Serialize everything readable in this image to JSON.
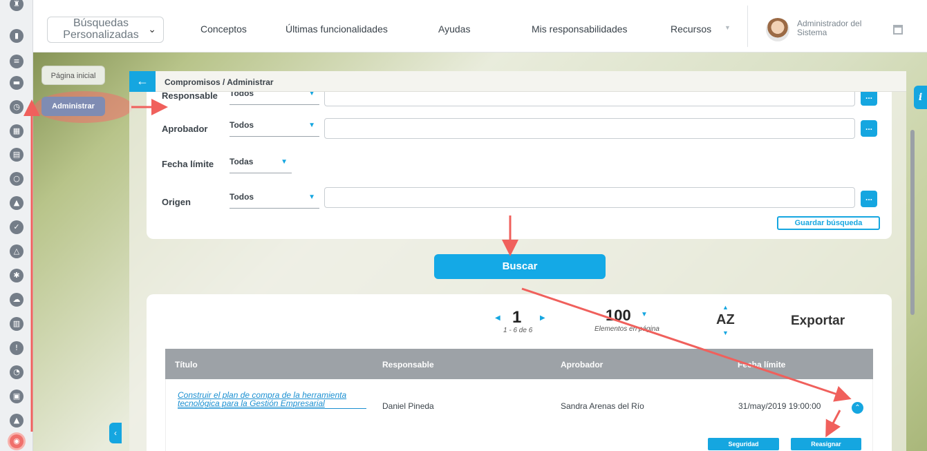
{
  "header": {
    "dropdown_label": "Búsquedas Personalizadas",
    "nav": [
      "Conceptos",
      "Últimas funcionalidades",
      "Ayudas",
      "Mis responsabilidades",
      "Recursos"
    ],
    "user_name": "Administrador del Sistema"
  },
  "menu": {
    "home": "Página inicial",
    "admin": "Administrar"
  },
  "breadcrumb": "Compromisos / Administrar",
  "filters": {
    "responsable": {
      "label": "Responsable",
      "value": "Todos"
    },
    "aprobador": {
      "label": "Aprobador",
      "value": "Todos"
    },
    "fecha_limite": {
      "label": "Fecha límite",
      "value": "Todas"
    },
    "origen": {
      "label": "Origen",
      "value": "Todos"
    },
    "dots": "...",
    "save_label": "Guardar búsqueda"
  },
  "search_label": "Buscar",
  "pagination": {
    "page": "1",
    "range": "1 - 6 de 6",
    "per_page": "100",
    "per_page_label": "Elementos en página",
    "sort_label": "AZ",
    "export_label": "Exportar"
  },
  "table": {
    "columns": [
      "Título",
      "Responsable",
      "Aprobador",
      "Fecha límite"
    ],
    "rows": [
      {
        "titulo": "Construir el plan de compra de la herramienta tecnológica para la Gestión Empresarial",
        "responsable": "Daniel Pineda",
        "aprobador": "Sandra Arenas del Río",
        "fecha": "31/may/2019 19:00:00",
        "actions": [
          "Seguridad",
          "Reasignar"
        ]
      }
    ]
  },
  "info_label": "i",
  "colors": {
    "accent": "#15a6e0",
    "annotation_arrow": "#f0605c",
    "header_row": "#9da2a7"
  }
}
